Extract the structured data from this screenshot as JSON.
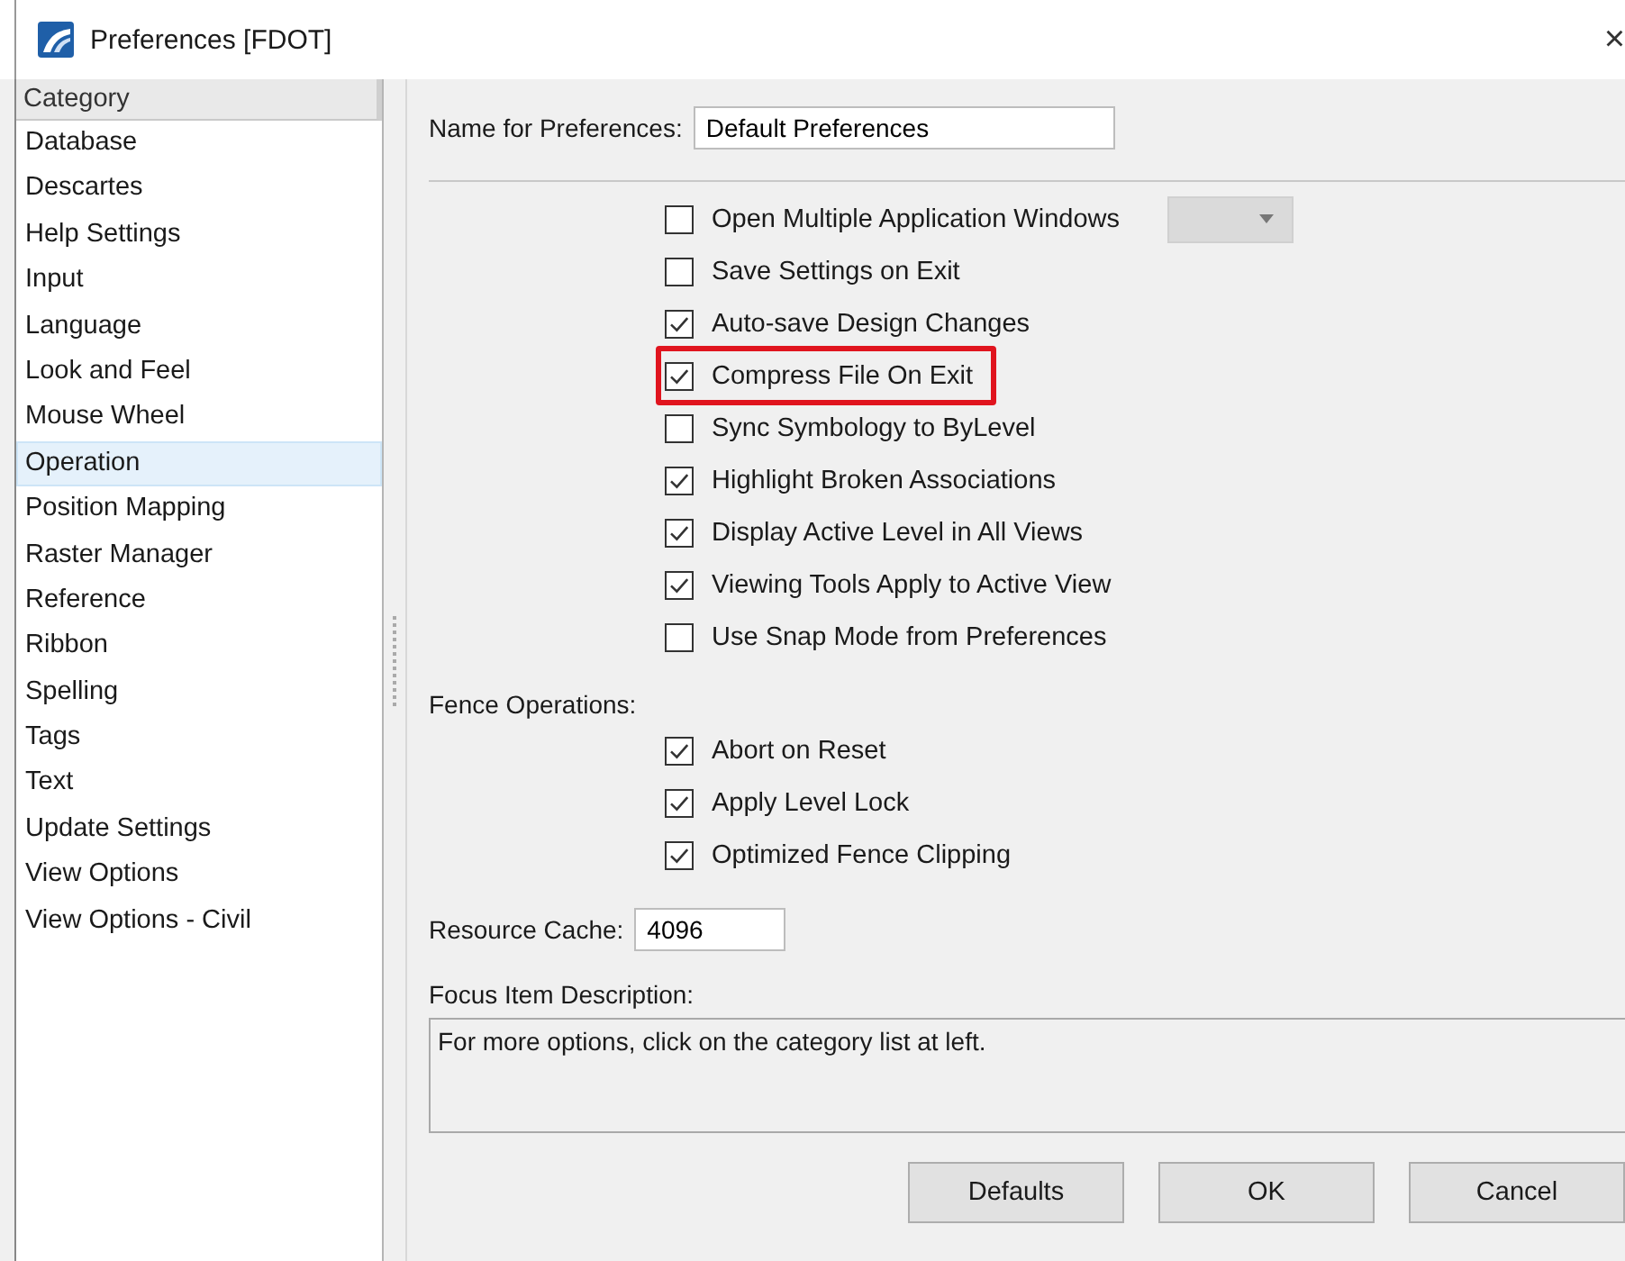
{
  "window": {
    "title": "Preferences [FDOT]",
    "close": "×"
  },
  "sidebar": {
    "header": "Category",
    "items": [
      {
        "label": "Database",
        "selected": false
      },
      {
        "label": "Descartes",
        "selected": false
      },
      {
        "label": "Help Settings",
        "selected": false
      },
      {
        "label": "Input",
        "selected": false
      },
      {
        "label": "Language",
        "selected": false
      },
      {
        "label": "Look and Feel",
        "selected": false
      },
      {
        "label": "Mouse Wheel",
        "selected": false
      },
      {
        "label": "Operation",
        "selected": true
      },
      {
        "label": "Position Mapping",
        "selected": false
      },
      {
        "label": "Raster Manager",
        "selected": false
      },
      {
        "label": "Reference",
        "selected": false
      },
      {
        "label": "Ribbon",
        "selected": false
      },
      {
        "label": "Spelling",
        "selected": false
      },
      {
        "label": "Tags",
        "selected": false
      },
      {
        "label": "Text",
        "selected": false
      },
      {
        "label": "Update Settings",
        "selected": false
      },
      {
        "label": "View Options",
        "selected": false
      },
      {
        "label": "View Options - Civil",
        "selected": false
      }
    ]
  },
  "name_field": {
    "label": "Name for Preferences:",
    "value": "Default Preferences"
  },
  "options": [
    {
      "label": "Open Multiple Application Windows",
      "checked": false,
      "highlighted": false,
      "dropdown": {
        "disabled": true
      }
    },
    {
      "label": "Save Settings on Exit",
      "checked": false,
      "highlighted": false
    },
    {
      "label": "Auto-save Design Changes",
      "checked": true,
      "highlighted": false
    },
    {
      "label": "Compress File On Exit",
      "checked": true,
      "highlighted": true
    },
    {
      "label": "Sync Symbology to ByLevel",
      "checked": false,
      "highlighted": false
    },
    {
      "label": "Highlight Broken Associations",
      "checked": true,
      "highlighted": false
    },
    {
      "label": "Display Active Level in All Views",
      "checked": true,
      "highlighted": false
    },
    {
      "label": "Viewing Tools Apply to Active View",
      "checked": true,
      "highlighted": false
    },
    {
      "label": "Use Snap Mode from Preferences",
      "checked": false,
      "highlighted": false
    }
  ],
  "fence_operations": {
    "label": "Fence Operations:",
    "options": [
      {
        "label": "Abort on Reset",
        "checked": true
      },
      {
        "label": "Apply Level Lock",
        "checked": true
      },
      {
        "label": "Optimized Fence Clipping",
        "checked": true
      }
    ]
  },
  "resource_cache": {
    "label": "Resource Cache:",
    "value": "4096"
  },
  "focus_description": {
    "label": "Focus Item Description:",
    "text": "For more options, click on the category list at left."
  },
  "buttons": [
    "Defaults",
    "OK",
    "Cancel"
  ]
}
